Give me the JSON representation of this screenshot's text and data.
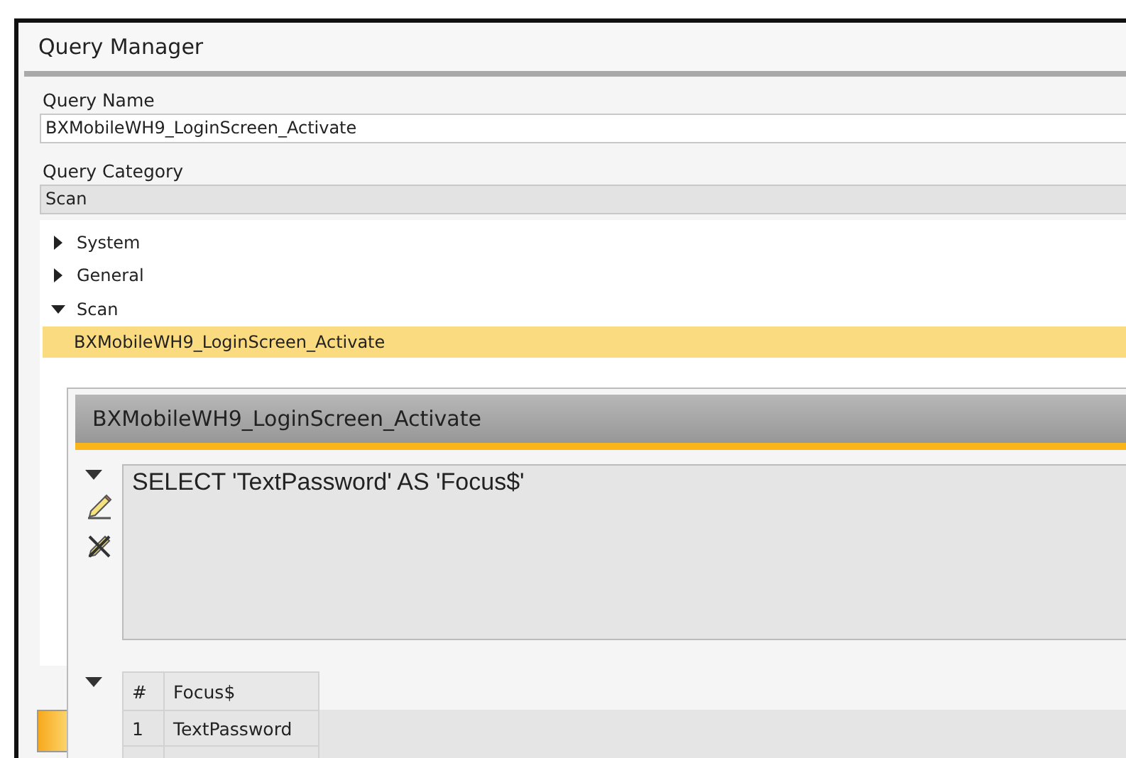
{
  "window": {
    "title": "Query Manager"
  },
  "query_name": {
    "label": "Query Name",
    "value": "BXMobileWH9_LoginScreen_Activate"
  },
  "query_category": {
    "label": "Query Category",
    "value": "Scan"
  },
  "tree": [
    {
      "label": "System",
      "expanded": false
    },
    {
      "label": "General",
      "expanded": false
    },
    {
      "label": "Scan",
      "expanded": true,
      "children": [
        {
          "label": "BXMobileWH9_LoginScreen_Activate",
          "selected": true
        }
      ]
    }
  ],
  "query_window": {
    "title": "BXMobileWH9_LoginScreen_Activate",
    "sql": "SELECT 'TextPassword' AS 'Focus$'",
    "results": {
      "columns": [
        "#",
        "Focus$"
      ],
      "rows": [
        [
          "1",
          "TextPassword"
        ]
      ]
    }
  }
}
